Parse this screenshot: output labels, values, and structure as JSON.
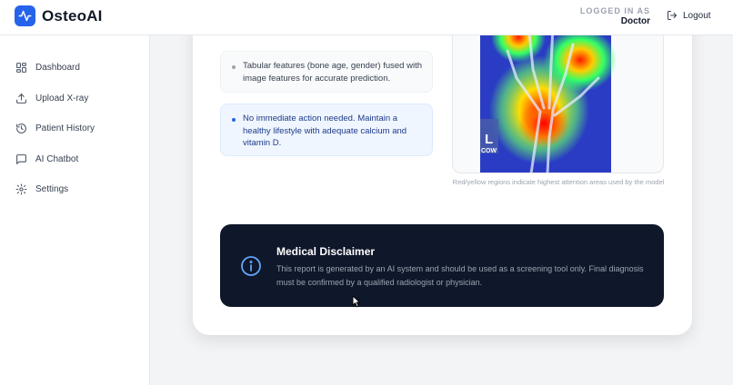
{
  "header": {
    "brand": "OsteoAI",
    "logged_in_label": "LOGGED IN AS",
    "logged_in_role": "Doctor",
    "logout_label": "Logout",
    "logo_icon": "activity-pulse-icon",
    "accent_color": "#2563eb"
  },
  "sidebar": {
    "items": [
      {
        "label": "Dashboard",
        "icon": "grid-icon"
      },
      {
        "label": "Upload X-ray",
        "icon": "upload-icon"
      },
      {
        "label": "Patient History",
        "icon": "history-icon"
      },
      {
        "label": "AI Chatbot",
        "icon": "chat-icon"
      },
      {
        "label": "Settings",
        "icon": "gear-icon"
      }
    ]
  },
  "report": {
    "feature_note": "Tabular features (bone age, gender) fused with image features for accurate prediction.",
    "recommendation": "No immediate action needed. Maintain a healthy lifestyle with adequate calcium and vitamin D.",
    "heatmap_caption": "Red/yellow regions indicate highest attention areas used by the model",
    "xray_marker": "L",
    "xray_marker_sub": "COW"
  },
  "disclaimer": {
    "title": "Medical Disclaimer",
    "text": "This report is generated by an AI system and should be used as a screening tool only. Final diagnosis must be confirmed by a qualified radiologist or physician.",
    "icon": "info-icon",
    "background_color": "#0f172a"
  }
}
